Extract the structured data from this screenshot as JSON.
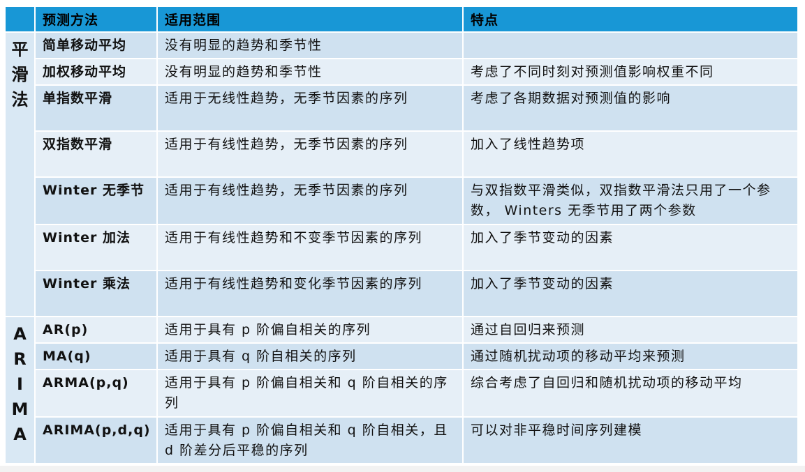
{
  "table": {
    "headers": [
      "",
      "预测方法",
      "适用范围",
      "特点"
    ],
    "groups": {
      "smoothing": [
        "平",
        "滑",
        "法"
      ],
      "arima": [
        "A",
        "R",
        "I",
        "M",
        "A"
      ]
    },
    "rows": [
      {
        "method": "简单移动平均",
        "scope": "没有明显的趋势和季节性",
        "feature": ""
      },
      {
        "method": "加权移动平均",
        "scope": "没有明显的趋势和季节性",
        "feature": "考虑了不同时刻对预测值影响权重不同"
      },
      {
        "method": "单指数平滑",
        "scope": "适用于无线性趋势，无季节因素的序列",
        "feature": "考虑了各期数据对预测值的影响"
      },
      {
        "method": "双指数平滑",
        "scope": "适用于有线性趋势，无季节因素的序列",
        "feature": "加入了线性趋势项"
      },
      {
        "method": "Winter 无季节",
        "scope": "适用于有线性趋势，无季节因素的序列",
        "feature": "与双指数平滑类似，双指数平滑法只用了一个参数， Winters 无季节用了两个参数"
      },
      {
        "method": "Winter 加法",
        "scope": "适用于有线性趋势和不变季节因素的序列",
        "feature": "加入了季节变动的因素"
      },
      {
        "method": "Winter 乘法",
        "scope": "适用于有线性趋势和变化季节因素的序列",
        "feature": "加入了季节变动的因素"
      },
      {
        "method": "AR(p)",
        "scope": "适用于具有 p 阶偏自相关的序列",
        "feature": "通过自回归来预测"
      },
      {
        "method": "MA(q)",
        "scope": "适用于具有 q 阶自相关的序列",
        "feature": "通过随机扰动项的移动平均来预测"
      },
      {
        "method": "ARMA(p,q)",
        "scope": "适用于具有 p 阶偏自相关和 q 阶自相关的序列",
        "feature": "综合考虑了自回归和随机扰动项的移动平均"
      },
      {
        "method": "ARIMA(p,d,q)",
        "scope": "适用于具有 p 阶偏自相关和 q 阶自相关，且 d 阶差分后平稳的序列",
        "feature": "可以对非平稳时间序列建模"
      }
    ]
  }
}
